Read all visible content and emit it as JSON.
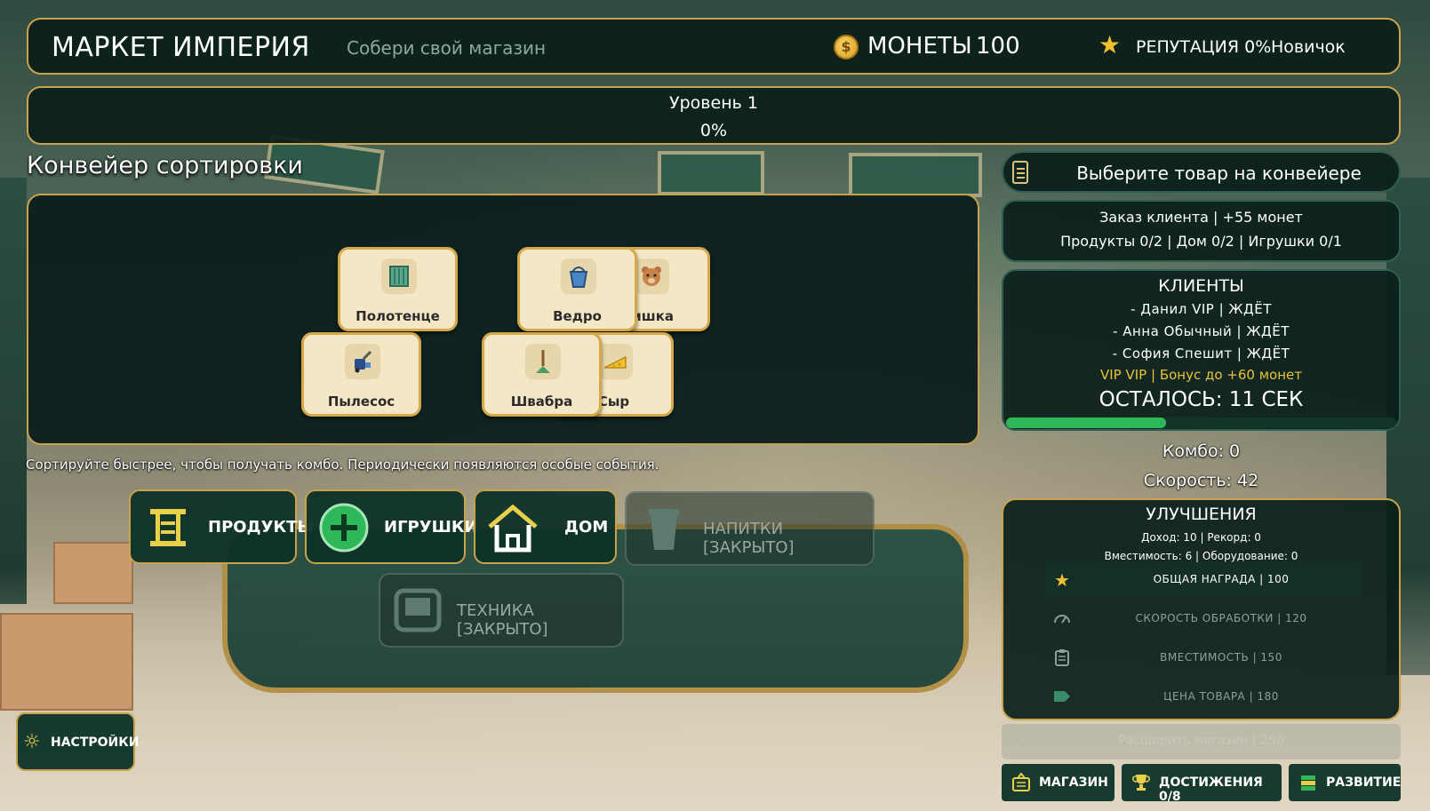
{
  "header": {
    "title": "МАРКЕТ ИМПЕРИЯ",
    "subtitle": "Собери свой магазин",
    "coins_label": "МОНЕТЫ",
    "coins_value": "100",
    "reputation_label": "РЕПУТАЦИЯ 0%",
    "rank": "Новичок"
  },
  "level": {
    "label": "Уровень 1",
    "percent": "0%",
    "progress": 0
  },
  "conveyor": {
    "title": "Конвейер сортировки",
    "items": [
      {
        "label": "Полотенце",
        "icon": "towel-icon"
      },
      {
        "label": "ишка",
        "icon": "teddy-bear-icon"
      },
      {
        "label": "Ведро",
        "icon": "bucket-icon"
      },
      {
        "label": "Пылесос",
        "icon": "vacuum-icon"
      },
      {
        "label": "Сыр",
        "icon": "cheese-icon"
      },
      {
        "label": "Швабра",
        "icon": "mop-icon"
      }
    ],
    "hint": "Сортируйте быстрее, чтобы получать комбо. Периодически появляются особые события."
  },
  "categories": [
    {
      "label": "ПРОДУКТЫ",
      "icon": "shelf-icon",
      "locked": false
    },
    {
      "label": "ИГРУШКИ",
      "icon": "plus-circle-icon",
      "locked": false
    },
    {
      "label": "ДОМ",
      "icon": "house-icon",
      "locked": false
    },
    {
      "label": "НАПИТКИ  [ЗАКРЫТО]",
      "icon": "cup-icon",
      "locked": true
    },
    {
      "label": "ТЕХНИКА  [ЗАКРЫТО]",
      "icon": "monitor-icon",
      "locked": true
    }
  ],
  "sidebar": {
    "select_prompt": "Выберите товар на конвейере",
    "order": {
      "title": "Заказ клиента | +55 монет",
      "requirements": "Продукты 0/2   |   Дом 0/2   |   Игрушки 0/1"
    },
    "clients": {
      "title": "КЛИЕНТЫ",
      "rows": [
        "- Данил  VIP  |  ЖДЁТ",
        "- Анна  Обычный  |  ЖДЁТ",
        "- София  Спешит  |  ЖДЁТ"
      ],
      "vip_bonus": "VIP  VIP   |   Бонус до +60 монет",
      "timer": "ОСТАЛОСЬ: 11 СЕК",
      "timer_fraction": 0.41
    },
    "combo": "Комбо: 0",
    "speed": "Скорость: 42",
    "upgrades": {
      "title": "УЛУЧШЕНИЯ",
      "stats_line1": "Доход: 10 | Рекорд: 0",
      "stats_line2": "Вместимость: 6 | Оборудование: 0",
      "items": [
        {
          "label": "ОБЩАЯ НАГРАДА  |  100",
          "icon": "star-icon",
          "active": true
        },
        {
          "label": "СКОРОСТЬ ОБРАБОТКИ  |  120",
          "icon": "gauge-icon",
          "active": false
        },
        {
          "label": "ВМЕСТИМОСТЬ  |  150",
          "icon": "clipboard-icon",
          "active": false
        },
        {
          "label": "ЦЕНА ТОВАРА  |  180",
          "icon": "tag-icon",
          "active": false
        }
      ]
    },
    "expand": "Расширить магазин | 250"
  },
  "bottom_nav": [
    {
      "label": "МАГАЗИН",
      "icon": "basket-icon"
    },
    {
      "label": "ДОСТИЖЕНИЯ 0/8",
      "icon": "trophy-icon"
    },
    {
      "label": "РАЗВИТИЕ",
      "icon": "stack-icon"
    }
  ],
  "settings_label": "НАСТРОЙКИ",
  "colors": {
    "accent_gold": "#c9a24d",
    "panel_bg": "#0a1e1a",
    "timer_green": "#2fb85a",
    "vip_yellow": "#e8c33a",
    "icon_yellow": "#e8d04a"
  }
}
